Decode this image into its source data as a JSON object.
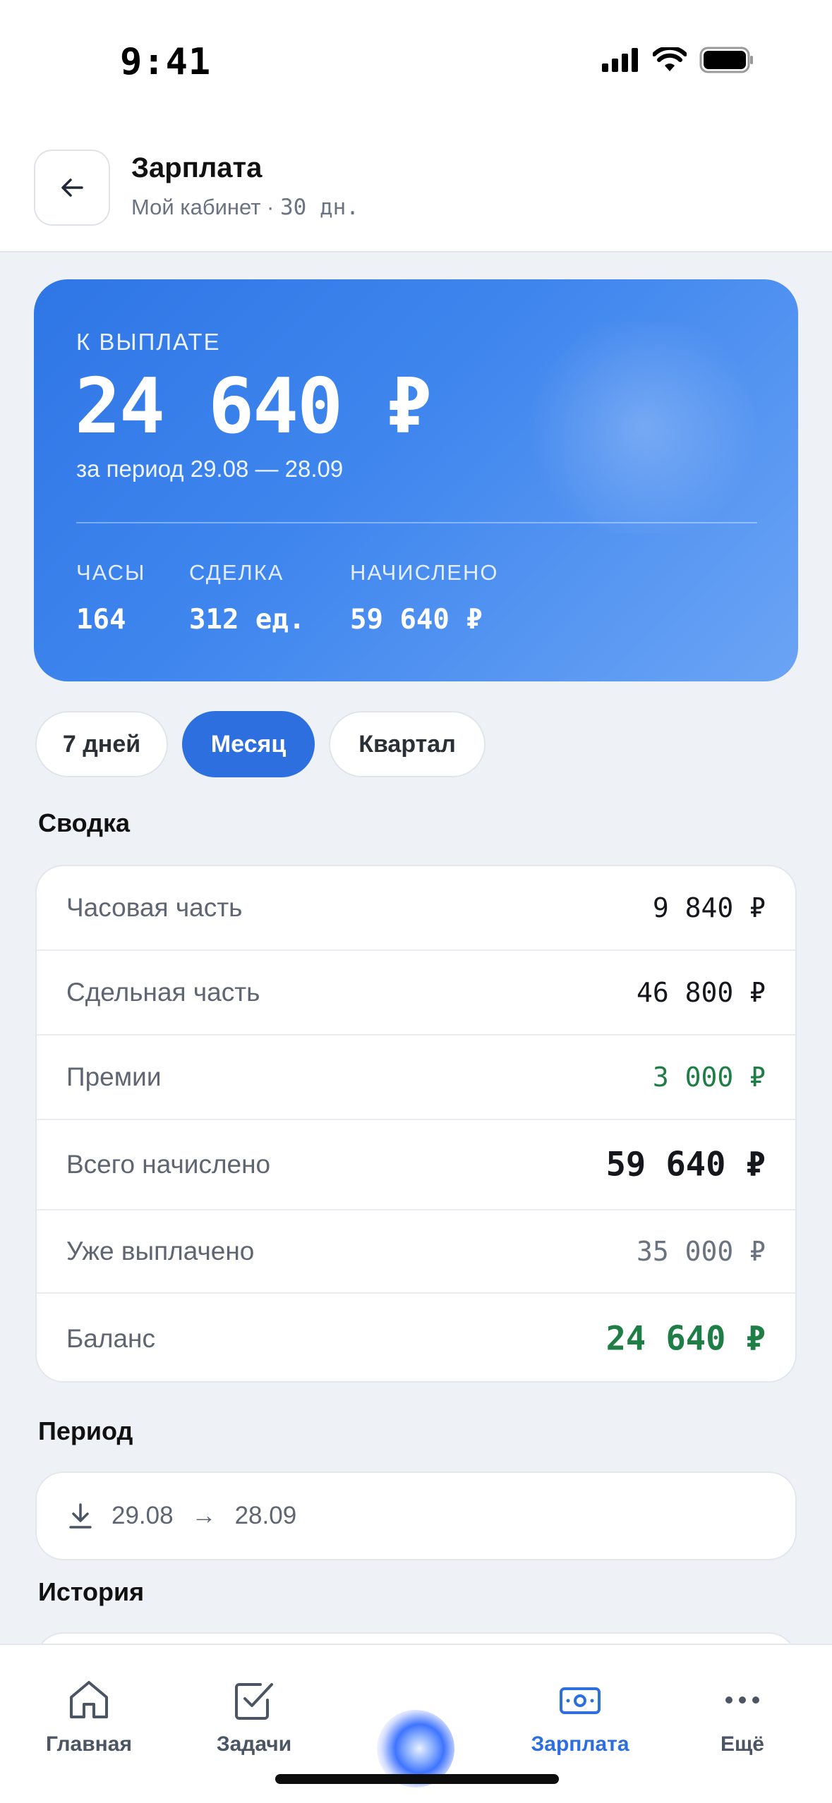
{
  "status": {
    "time": "9:41"
  },
  "header": {
    "title": "Зарплата",
    "subtitle_prefix": "Мой кабинет · ",
    "subtitle_days": "30 дн."
  },
  "hero": {
    "label": "К ВЫПЛАТЕ",
    "amount": "24 640 ₽",
    "period": "за период 29.08 — 28.09",
    "stats": [
      {
        "key": "ЧАСЫ",
        "value": "164"
      },
      {
        "key": "СДЕЛКА",
        "value": "312 ед."
      },
      {
        "key": "НАЧИСЛЕНО",
        "value": "59 640 ₽"
      }
    ]
  },
  "segments": {
    "week": "7 дней",
    "month": "Месяц",
    "quarter": "Квартал",
    "selected": "Месяц"
  },
  "summary": {
    "title": "Сводка",
    "rows": [
      {
        "label": "Часовая часть",
        "value": "9 840 ₽"
      },
      {
        "label": "Сдельная часть",
        "value": "46 800 ₽"
      },
      {
        "label": "Премии",
        "value": "3 000 ₽"
      },
      {
        "label": "Всего начислено",
        "value": "59 640 ₽"
      },
      {
        "label": "Уже выплачено",
        "value": "35 000 ₽"
      },
      {
        "label": "Баланс",
        "value": "24 640 ₽"
      }
    ]
  },
  "period": {
    "title": "Период",
    "from": "29.08",
    "arrow": "→",
    "to": "28.09"
  },
  "history": {
    "title": "История"
  },
  "tabbar": {
    "items": [
      {
        "label": "Главная",
        "icon": "home-icon"
      },
      {
        "label": "Задачи",
        "icon": "tasks-icon"
      },
      {
        "label": "Зарплата",
        "icon": "money-icon"
      },
      {
        "label": "Ещё",
        "icon": "more-icon"
      }
    ],
    "active": "Зарплата"
  },
  "colors": {
    "accent": "#2e6fe0",
    "positive": "#1e7e45",
    "background": "#eef1f5"
  }
}
